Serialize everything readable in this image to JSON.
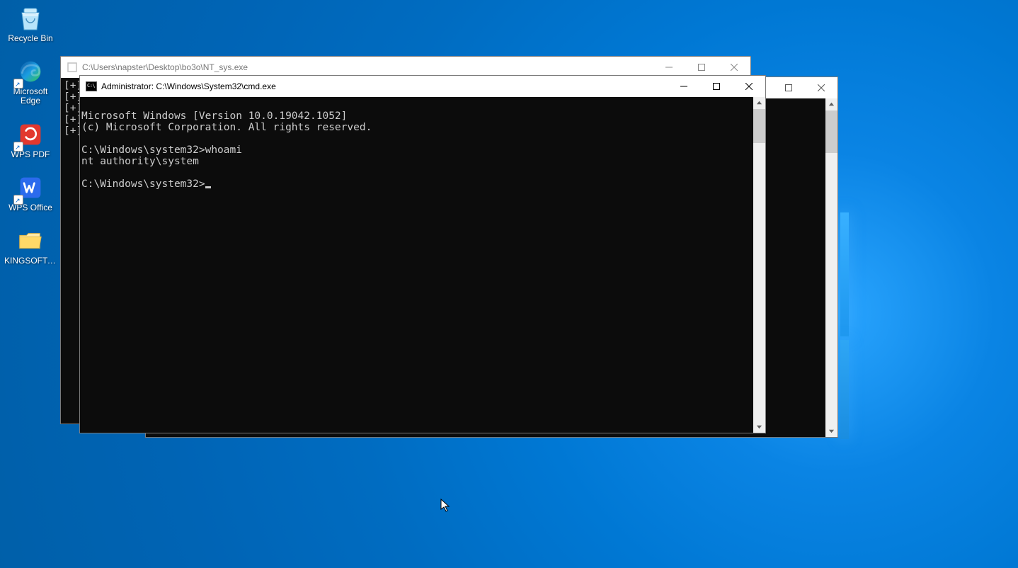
{
  "desktop": {
    "icons": [
      {
        "name": "recycle-bin",
        "label": "Recycle Bin"
      },
      {
        "name": "microsoft-edge",
        "label": "Microsoft Edge"
      },
      {
        "name": "wps-pdf",
        "label": "WPS PDF"
      },
      {
        "name": "wps-office",
        "label": "WPS Office"
      },
      {
        "name": "kingsoft-folder",
        "label": "KINGSOFT-..."
      }
    ]
  },
  "windows": {
    "bg1": {
      "title": "C:\\Users\\napster\\Desktop\\bo3o\\NT_sys.exe",
      "body_lines": [
        "[+]",
        "[+]",
        "[+]",
        "[+]",
        "[+]"
      ]
    },
    "bg2": {
      "title": ""
    },
    "cmd": {
      "title": "Administrator: C:\\Windows\\System32\\cmd.exe",
      "lines": {
        "l1": "Microsoft Windows [Version 10.0.19042.1052]",
        "l2": "(c) Microsoft Corporation. All rights reserved.",
        "l3": "",
        "l4": "C:\\Windows\\system32>whoami",
        "l5": "nt authority\\system",
        "l6": "",
        "l7": "C:\\Windows\\system32>"
      }
    }
  }
}
